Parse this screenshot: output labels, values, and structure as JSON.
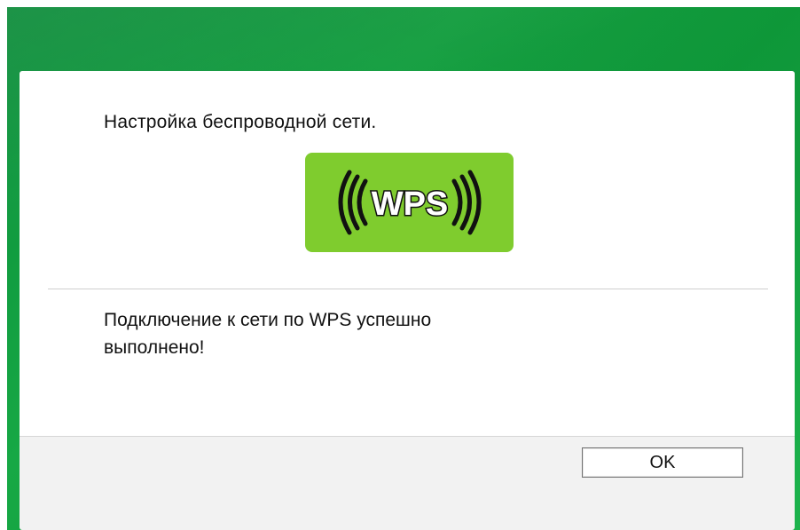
{
  "dialog": {
    "heading": "Настройка беспроводной сети.",
    "logo_text": "WPS",
    "message_line1": "Подключение к сети по WPS успешно",
    "message_line2": "выполнено!",
    "ok_label": "OK"
  },
  "colors": {
    "title_bar": "#17a845",
    "badge": "#7fcc2e",
    "logo_text": "#ffffff",
    "logo_waves": "#111111"
  }
}
